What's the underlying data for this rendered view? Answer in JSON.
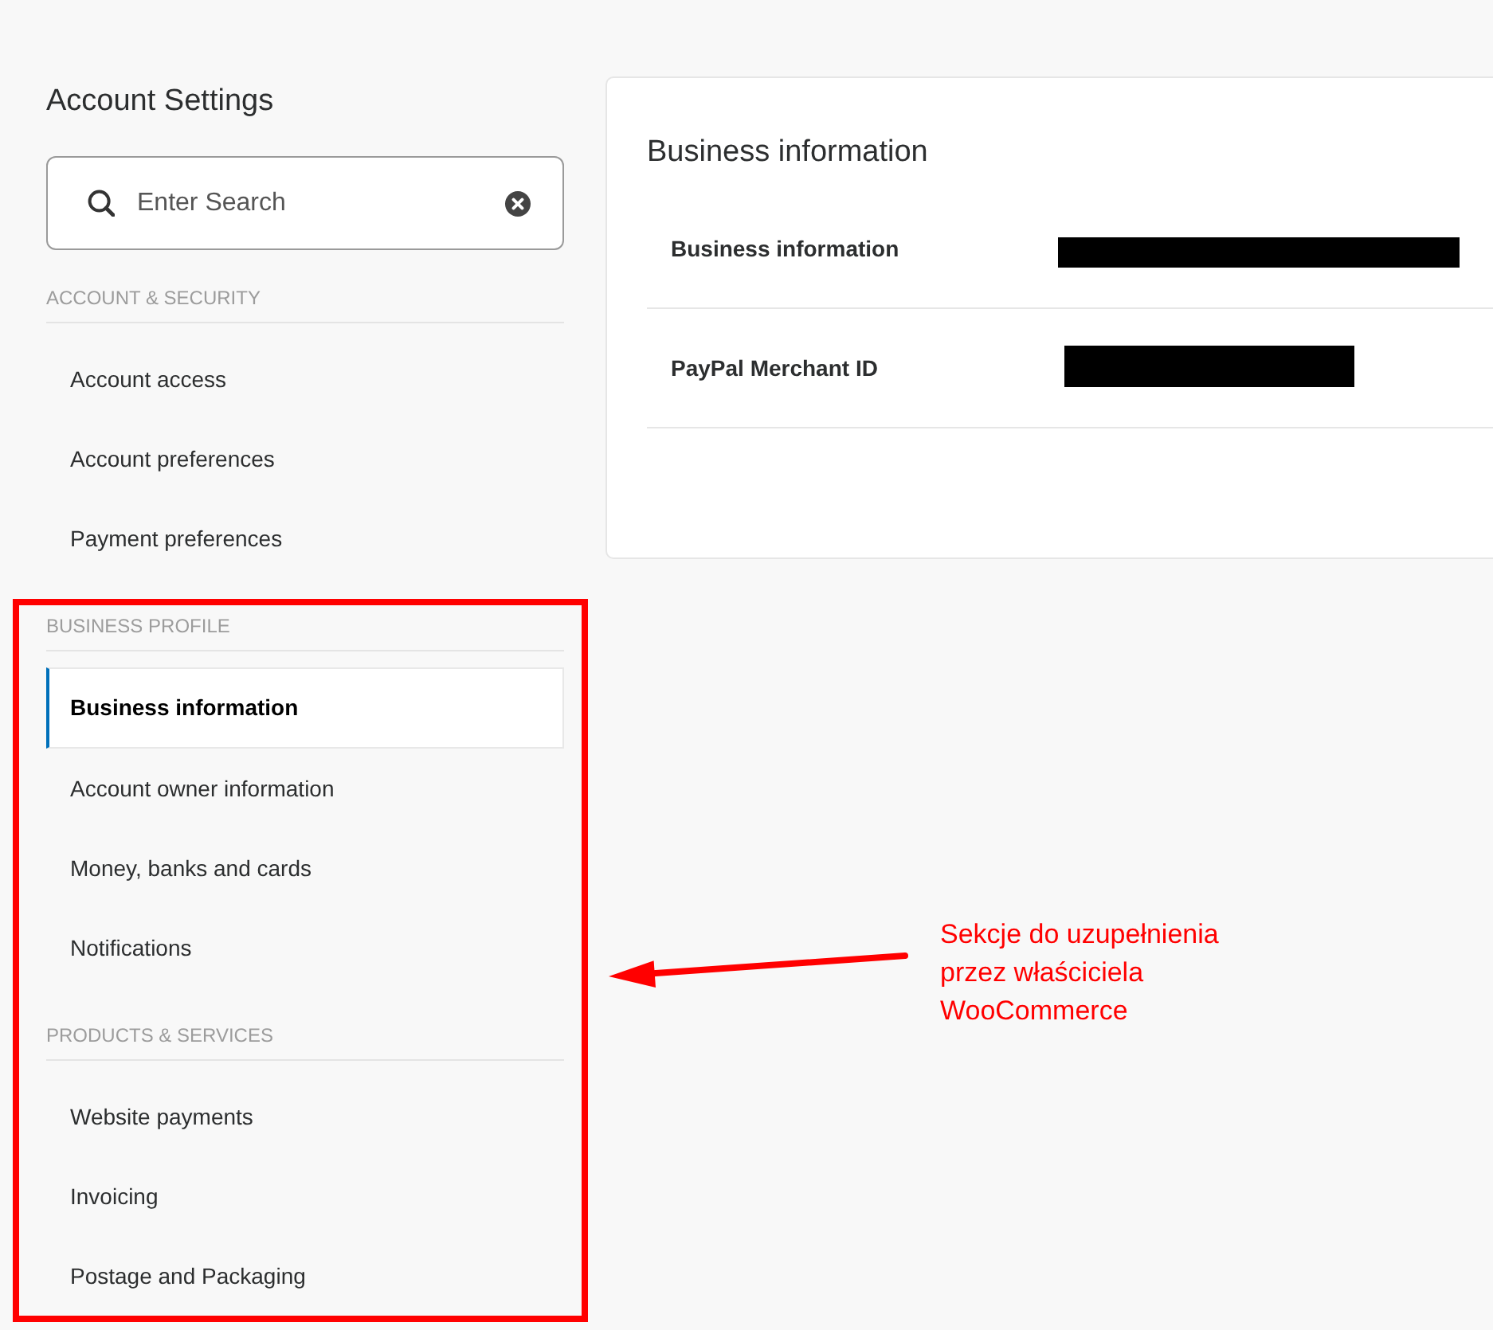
{
  "page": {
    "title": "Account Settings"
  },
  "search": {
    "placeholder": "Enter Search"
  },
  "sidebar": {
    "sections": [
      {
        "heading": "ACCOUNT & SECURITY",
        "highlighted": false,
        "items": [
          {
            "label": "Account access",
            "selected": false
          },
          {
            "label": "Account preferences",
            "selected": false
          },
          {
            "label": "Payment preferences",
            "selected": false
          }
        ]
      },
      {
        "heading": "BUSINESS PROFILE",
        "highlighted": true,
        "items": [
          {
            "label": "Business information",
            "selected": true
          },
          {
            "label": "Account owner information",
            "selected": false
          },
          {
            "label": "Money, banks and cards",
            "selected": false
          },
          {
            "label": "Notifications",
            "selected": false
          }
        ]
      },
      {
        "heading": "PRODUCTS & SERVICES",
        "highlighted": true,
        "items": [
          {
            "label": "Website payments",
            "selected": false
          },
          {
            "label": "Invoicing",
            "selected": false
          },
          {
            "label": "Postage and Packaging",
            "selected": false
          }
        ]
      }
    ]
  },
  "content": {
    "title": "Business information",
    "rows": [
      {
        "label": "Business information",
        "redacted": true
      },
      {
        "label": "PayPal Merchant ID",
        "redacted": true
      }
    ]
  },
  "annotation": {
    "lines": [
      "Sekcje do uzupełnienia",
      "przez właściciela",
      "WooCommerce"
    ]
  }
}
